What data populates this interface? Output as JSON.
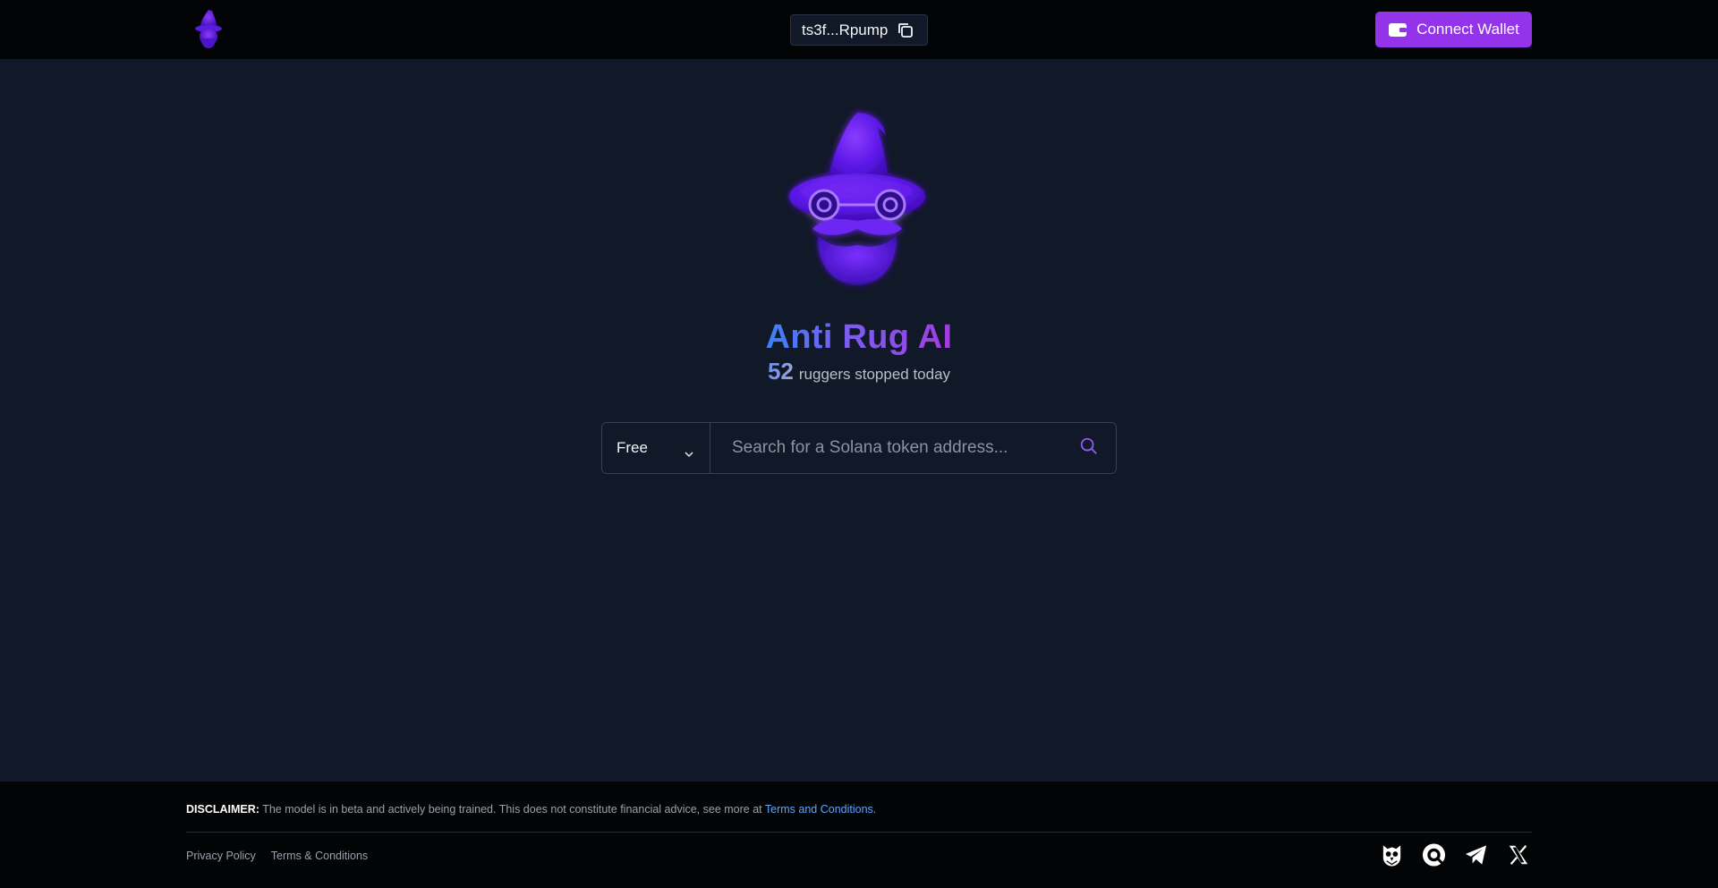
{
  "header": {
    "token_address_short": "ts3f...Rpump",
    "connect_label": "Connect Wallet"
  },
  "hero": {
    "title": "Anti Rug AI",
    "count": "52",
    "count_text": "ruggers stopped today"
  },
  "search": {
    "plan_selected": "Free",
    "placeholder": "Search for a Solana token address..."
  },
  "footer": {
    "disclaimer_label": "DISCLAIMER:",
    "disclaimer_text": "The model is in beta and actively being trained. This does not constitute financial advice, see more at",
    "disclaimer_link": "Terms and Conditions",
    "disclaimer_end": ".",
    "links": [
      "Privacy Policy",
      "Terms & Conditions"
    ]
  },
  "icons": {
    "logo": "wizard-logo-icon",
    "copy": "copy-icon",
    "wallet": "wallet-icon",
    "chevron": "chevron-down-icon",
    "search": "search-icon",
    "socials": [
      "owl-icon",
      "target-icon",
      "telegram-icon",
      "x-icon"
    ]
  },
  "colors": {
    "accent": "#9333ea",
    "background": "#111827",
    "header_bg": "#030405",
    "link": "#60a5fa"
  }
}
